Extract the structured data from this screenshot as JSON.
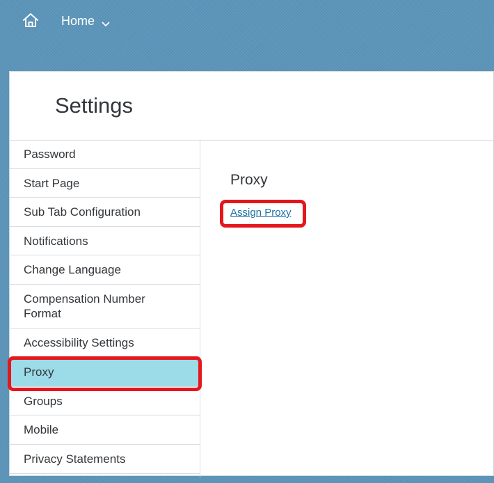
{
  "header": {
    "home_label": "Home"
  },
  "page": {
    "title": "Settings"
  },
  "sidebar": {
    "items": [
      {
        "label": "Password"
      },
      {
        "label": "Start Page"
      },
      {
        "label": "Sub Tab Configuration"
      },
      {
        "label": "Notifications"
      },
      {
        "label": "Change Language"
      },
      {
        "label": "Compensation Number Format"
      },
      {
        "label": "Accessibility Settings"
      },
      {
        "label": "Proxy",
        "selected": true
      },
      {
        "label": "Groups"
      },
      {
        "label": "Mobile"
      },
      {
        "label": "Privacy Statements"
      }
    ]
  },
  "content": {
    "section_title": "Proxy",
    "assign_proxy_link": "Assign Proxy"
  },
  "colors": {
    "header_background": "#5b95ba",
    "selected_item_background": "#9cdbe8",
    "highlight_outline": "#e4171d",
    "link": "#1d6fa3"
  },
  "icons": {
    "home": "home-icon",
    "home_menu_chevron": "chevron-down-icon"
  }
}
